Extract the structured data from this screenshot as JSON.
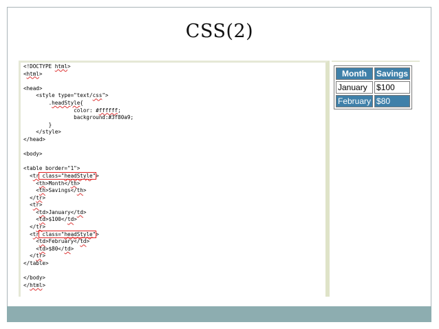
{
  "slide": {
    "title": "CSS(2)"
  },
  "code": {
    "lines": [
      "<!DOCTYPE html>",
      "<html>",
      "",
      "<head>",
      "    <style type=\"text/css\">",
      "        .headStyle{",
      "                color: #ffffff;",
      "                background:#3f80a9;",
      "        }",
      "    </style>",
      "</head>",
      "",
      "<body>",
      "",
      "<table border=\"1\">",
      "  <tr class=\"headStyle\">",
      "    <th>Month</th>",
      "    <th>Savings</th>",
      "  </tr>",
      "  <tr>",
      "    <td>January</td>",
      "    <td>$100</td>",
      "  </tr>",
      "  <tr class=\"headStyle\">",
      "    <td>February</td>",
      "    <td>$80</td>",
      "  </tr>",
      "</table>",
      "",
      "</body>",
      "</html>"
    ]
  },
  "result_table": {
    "header": [
      "Month",
      "Savings"
    ],
    "rows": [
      [
        "January",
        "$100"
      ],
      [
        "February",
        "$80"
      ]
    ]
  },
  "colors": {
    "head_style_bg": "#3f80a9",
    "head_style_fg": "#ffffff",
    "highlight_box": "#e02020",
    "footer_bar": "#8dadb0"
  }
}
